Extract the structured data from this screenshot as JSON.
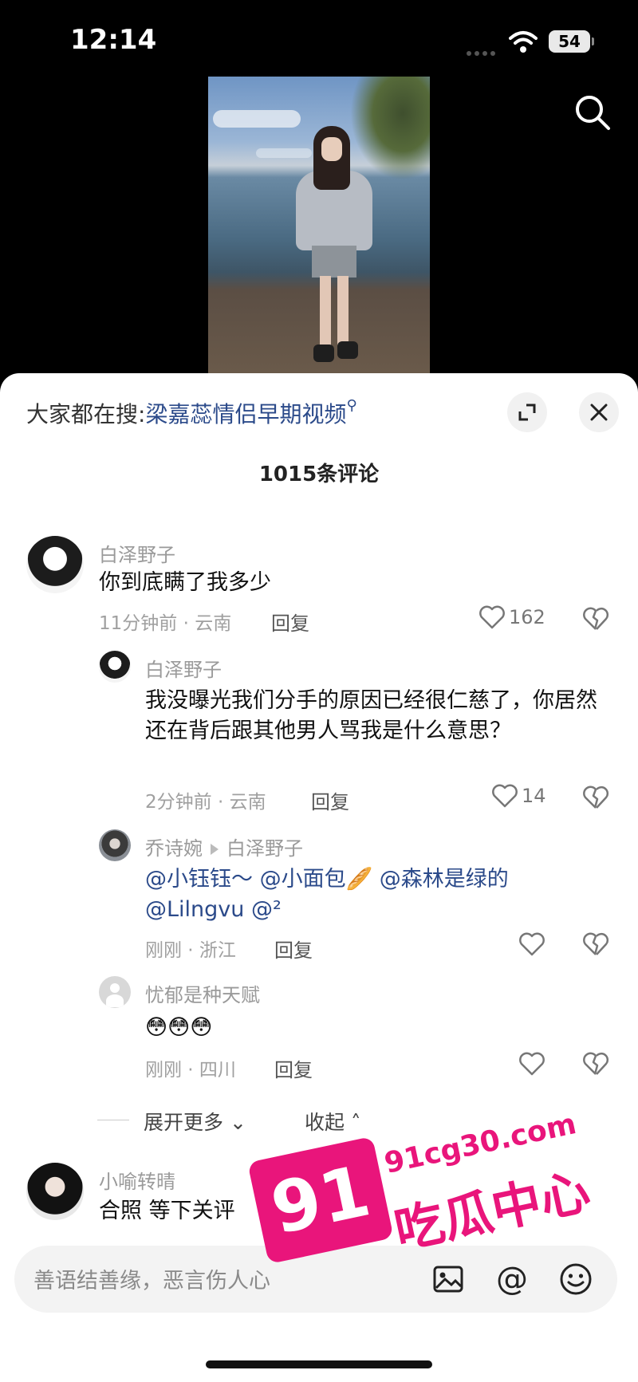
{
  "status": {
    "time": "12:14",
    "battery": "54"
  },
  "sheet": {
    "trending_prefix": "大家都在搜:",
    "trending_keyword": "梁嘉蕊情侣早期视频",
    "comment_count": "1015条评论"
  },
  "comments": [
    {
      "user": "白泽野子",
      "text": "你到底瞒了我多少",
      "time": "11分钟前 · 云南",
      "reply": "回复",
      "likes": "162"
    },
    {
      "user": "白泽野子",
      "text": "我没曝光我们分手的原因已经很仁慈了，你居然还在背后跟其他男人骂我是什么意思？",
      "time": "2分钟前 · 云南",
      "reply": "回复",
      "likes": "14"
    },
    {
      "user": "乔诗婉",
      "reply_to": "白泽野子",
      "mentions_line1": "@小钰钰～ @小面包🥖 @森林是绿的",
      "mentions_line2": "@Lilngvu @²",
      "time": "刚刚 · 浙江",
      "reply": "回复"
    },
    {
      "user": "忧郁是种天赋",
      "text": "😳😳😳",
      "time": "刚刚 · 四川",
      "reply": "回复"
    },
    {
      "user": "小喻转晴",
      "text": "合照 等下关评"
    }
  ],
  "expand": {
    "more": "展开更多",
    "collapse": "收起"
  },
  "input": {
    "placeholder": "善语结善缘，恶言伤人心"
  },
  "watermark": {
    "badge": "91",
    "url": "91cg30.com",
    "name": "吃瓜中心"
  }
}
